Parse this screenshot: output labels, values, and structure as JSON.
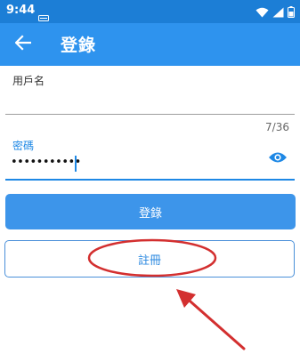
{
  "status_bar": {
    "time": "9:44",
    "icons": [
      "notification-icon",
      "wifi-icon",
      "signal-icon",
      "battery-icon"
    ]
  },
  "app_bar": {
    "title": "登錄",
    "back_icon": "arrow-back-icon",
    "background": "#2e93ee"
  },
  "form": {
    "username": {
      "label": "用戶名",
      "value": ""
    },
    "password": {
      "label": "密碼",
      "masked_value": "•••••••••••",
      "counter": "7/36",
      "toggle_icon": "eye-icon"
    },
    "login_button_label": "登錄",
    "register_button_label": "註冊"
  },
  "annotation": {
    "color": "#d32f2f",
    "shapes": [
      "ellipse",
      "arrow"
    ]
  },
  "colors": {
    "accent": "#1e88e5",
    "status_bar": "#1c7ed6"
  }
}
